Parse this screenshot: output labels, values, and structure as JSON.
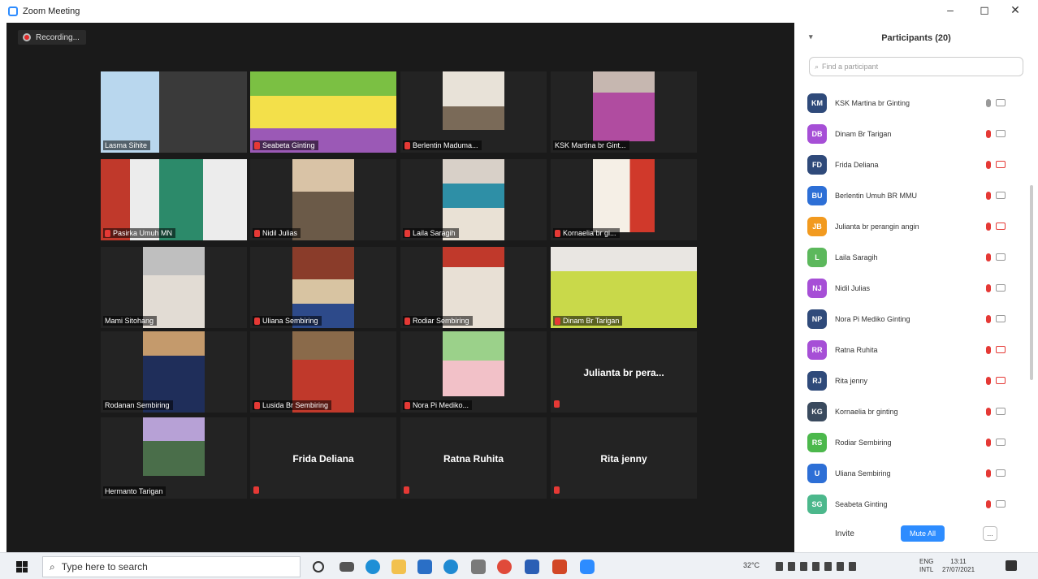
{
  "window": {
    "title": "Zoom Meeting",
    "minimize": "–",
    "maximize": "◻",
    "close": "✕"
  },
  "recording": {
    "label": "Recording..."
  },
  "tiles": [
    {
      "name": "Lasma Sihite",
      "muted": false,
      "camera": true,
      "active": true
    },
    {
      "name": "Seabeta Ginting",
      "muted": true,
      "camera": true
    },
    {
      "name": "Berlentin Maduma...",
      "muted": true,
      "camera": true
    },
    {
      "name": "KSK Martina br Gint...",
      "muted": false,
      "camera": true
    },
    {
      "name": "Pasirka Umuh MN",
      "muted": true,
      "camera": true
    },
    {
      "name": "Nidil Julias",
      "muted": true,
      "camera": true
    },
    {
      "name": "Laila Saragih",
      "muted": true,
      "camera": true
    },
    {
      "name": "Kornaelia br gi...",
      "muted": true,
      "camera": true
    },
    {
      "name": "Mami Sitohang",
      "muted": false,
      "camera": true
    },
    {
      "name": "Uliana Sembiring",
      "muted": true,
      "camera": true
    },
    {
      "name": "Rodiar Sembiring",
      "muted": true,
      "camera": true
    },
    {
      "name": "Dinam Br Tarigan",
      "muted": true,
      "camera": true
    },
    {
      "name": "Rodanan Sembiring",
      "muted": false,
      "camera": true
    },
    {
      "name": "Lusida Br Sembiring",
      "muted": true,
      "camera": true
    },
    {
      "name": "Nora Pi Mediko...",
      "muted": true,
      "camera": true
    },
    {
      "name": "Julianta br pera...",
      "muted": true,
      "camera": false
    },
    {
      "name": "Hermanto Tarigan",
      "muted": false,
      "camera": true
    },
    {
      "name": "Frida Deliana",
      "muted": true,
      "camera": false
    },
    {
      "name": "Ratna Ruhita",
      "muted": true,
      "camera": false
    },
    {
      "name": "Rita jenny",
      "muted": true,
      "camera": false
    }
  ],
  "participants_panel": {
    "title": "Participants (20)",
    "search_placeholder": "Find a participant",
    "items": [
      {
        "initials": "KM",
        "name": "KSK Martina br Ginting",
        "color": "#2f4a7a",
        "mic_muted": false,
        "cam_off": false
      },
      {
        "initials": "DB",
        "name": "Dinam Br Tarigan",
        "color": "#a64fd6",
        "mic_muted": true,
        "cam_off": false
      },
      {
        "initials": "FD",
        "name": "Frida Deliana",
        "color": "#2f4a7a",
        "mic_muted": true,
        "cam_off": true
      },
      {
        "initials": "BU",
        "name": "Berlentin Umuh BR MMU",
        "color": "#2d6fd6",
        "mic_muted": true,
        "cam_off": false
      },
      {
        "initials": "JB",
        "name": "Julianta br perangin angin",
        "color": "#f29a1f",
        "mic_muted": true,
        "cam_off": true
      },
      {
        "initials": "L",
        "name": "Laila Saragih",
        "color": "#5cb85c",
        "mic_muted": true,
        "cam_off": false
      },
      {
        "initials": "NJ",
        "name": "Nidil Julias",
        "color": "#a64fd6",
        "mic_muted": true,
        "cam_off": false
      },
      {
        "initials": "NP",
        "name": "Nora Pi Mediko Ginting",
        "color": "#2f4a7a",
        "mic_muted": true,
        "cam_off": false
      },
      {
        "initials": "RR",
        "name": "Ratna Ruhita",
        "color": "#a64fd6",
        "mic_muted": true,
        "cam_off": true
      },
      {
        "initials": "RJ",
        "name": "Rita jenny",
        "color": "#2f4a7a",
        "mic_muted": true,
        "cam_off": true
      },
      {
        "initials": "KG",
        "name": "Kornaelia br ginting",
        "color": "#3a4a5e",
        "mic_muted": true,
        "cam_off": false
      },
      {
        "initials": "RS",
        "name": "Rodiar Sembiring",
        "color": "#4cb84c",
        "mic_muted": true,
        "cam_off": false
      },
      {
        "initials": "U",
        "name": "Uliana Sembiring",
        "color": "#2d6fd6",
        "mic_muted": true,
        "cam_off": false
      },
      {
        "initials": "SG",
        "name": "Seabeta Ginting",
        "color": "#4cb88c",
        "mic_muted": true,
        "cam_off": false
      }
    ],
    "invite": "Invite",
    "mute_all": "Mute All",
    "more": "..."
  },
  "taskbar": {
    "search_placeholder": "Type here to search",
    "temperature": "32°C",
    "lang": "ENG",
    "region": "INTL",
    "time": "13:11",
    "date": "27/07/2021"
  },
  "colors": {
    "zoom_blue": "#2d8cff",
    "active_speaker": "#c9e86a",
    "muted_red": "#e53935"
  }
}
